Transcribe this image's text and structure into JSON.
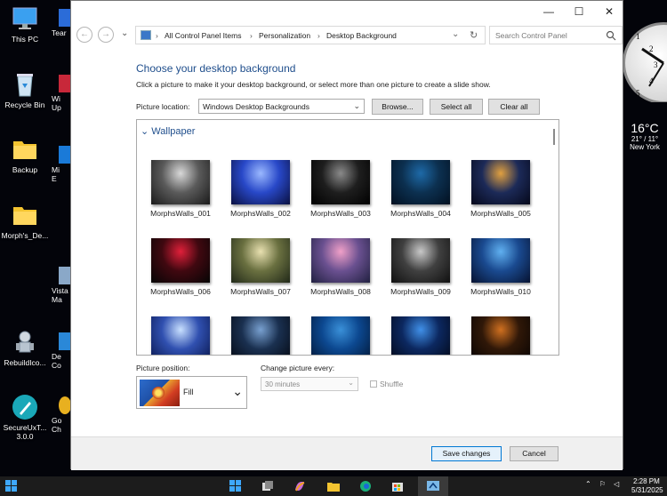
{
  "desktop": {
    "icons": [
      {
        "label": "This PC",
        "glyph": "monitor-icon"
      },
      {
        "label": "Recycle Bin",
        "glyph": "recycle-bin-icon"
      },
      {
        "label": "Backup",
        "glyph": "folder-icon"
      },
      {
        "label": "Morph's_De...",
        "glyph": "folder-icon"
      },
      {
        "label": "RebuildIco...",
        "glyph": "robot-icon"
      },
      {
        "label": "SecureUxT...",
        "glyph": "pen-icon"
      },
      {
        "label": "3.0.0",
        "glyph": ""
      }
    ],
    "partial_labels": [
      "Tear",
      "Wi",
      "Up",
      "Mi",
      "E",
      "Vista",
      "Ma",
      "De",
      "Co",
      "Go",
      "Ch"
    ]
  },
  "clock_gadget": {
    "numbers": [
      "1",
      "2",
      "3",
      "4",
      "5"
    ]
  },
  "weather_gadget": {
    "temp": "16°C",
    "range": "21° / 11°",
    "city": "New York"
  },
  "window": {
    "controls": {
      "minimize": "—",
      "maximize": "☐",
      "close": "✕"
    },
    "nav": {
      "back": "←",
      "forward": "→",
      "recent": "⌄"
    },
    "breadcrumb": [
      "All Control Panel Items",
      "Personalization",
      "Desktop Background"
    ],
    "breadcrumb_sep": "›",
    "search_placeholder": "Search Control Panel",
    "heading": "Choose your desktop background",
    "instruction": "Click a picture to make it your desktop background, or select more than one picture to create a slide show.",
    "picture_location_label": "Picture location:",
    "picture_location_value": "Windows Desktop Backgrounds",
    "buttons": {
      "browse": "Browse...",
      "select_all": "Select all",
      "clear_all": "Clear all"
    },
    "group_title": "Wallpaper",
    "wallpapers": [
      {
        "name": "MorphsWalls_001",
        "colors": [
          "#d8d8d8",
          "#5a5a5a",
          "#1a1a1a"
        ]
      },
      {
        "name": "MorphsWalls_002",
        "colors": [
          "#9ab8ff",
          "#2848c8",
          "#0a1040"
        ]
      },
      {
        "name": "MorphsWalls_003",
        "colors": [
          "#8a8a8a",
          "#1e1e1e",
          "#000000"
        ]
      },
      {
        "name": "MorphsWalls_004",
        "colors": [
          "#1e6aa8",
          "#0c3050",
          "#021020"
        ]
      },
      {
        "name": "MorphsWalls_005",
        "colors": [
          "#e0a040",
          "#1c2a58",
          "#05081a"
        ]
      },
      {
        "name": "MorphsWalls_006",
        "colors": [
          "#e0203a",
          "#400810",
          "#050505"
        ]
      },
      {
        "name": "MorphsWalls_007",
        "colors": [
          "#e8e0b0",
          "#6a7040",
          "#202818"
        ]
      },
      {
        "name": "MorphsWalls_008",
        "colors": [
          "#f0a0c8",
          "#6a5090",
          "#202040"
        ]
      },
      {
        "name": "MorphsWalls_009",
        "colors": [
          "#c8c8c8",
          "#404040",
          "#101010"
        ]
      },
      {
        "name": "MorphsWalls_010",
        "colors": [
          "#60b0f0",
          "#1a4a90",
          "#061230"
        ]
      },
      {
        "name": "",
        "colors": [
          "#c8e0ff",
          "#3050b0",
          "#0a1850"
        ]
      },
      {
        "name": "",
        "colors": [
          "#78a0d0",
          "#1a3050",
          "#050a14"
        ]
      },
      {
        "name": "",
        "colors": [
          "#3a90d8",
          "#0c4890",
          "#021838"
        ]
      },
      {
        "name": "",
        "colors": [
          "#4090e8",
          "#0c2860",
          "#020818"
        ]
      },
      {
        "name": "",
        "colors": [
          "#d07020",
          "#301808",
          "#080402"
        ]
      }
    ],
    "picture_position_label": "Picture position:",
    "picture_position_value": "Fill",
    "change_every_label": "Change picture every:",
    "change_every_value": "30 minutes",
    "shuffle_label": "Shuffle",
    "save_label": "Save changes",
    "cancel_label": "Cancel"
  },
  "taskbar": {
    "icons": [
      "windows-start-icon",
      "task-view-icon",
      "copilot-icon",
      "file-explorer-icon",
      "edge-icon",
      "store-icon",
      "control-panel-icon"
    ],
    "time": "2:28 PM",
    "date": "5/31/2025"
  },
  "colors": {
    "accent": "#1f4e8c",
    "footer_bg": "#f0f0f0",
    "button_bg": "#e1e1e1",
    "taskbar_bg": "#1c1c1c"
  }
}
